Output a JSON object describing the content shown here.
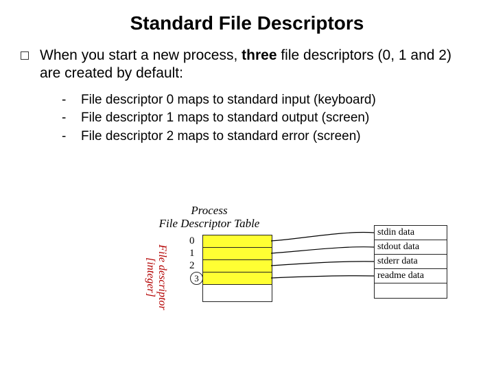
{
  "title": "Standard File Descriptors",
  "main_bullet_pre": "When you start a new process, ",
  "main_bullet_bold": "three",
  "main_bullet_post": " file descriptors (0, 1 and 2) are created by default:",
  "sub_items": [
    "File descriptor 0 maps to standard input (keyboard)",
    "File descriptor 1 maps to standard output (screen)",
    "File descriptor 2 maps to standard error (screen)"
  ],
  "diagram": {
    "title_line1": "Process",
    "title_line2": "File Descriptor Table",
    "fd_labels": [
      "0",
      "1",
      "2"
    ],
    "fd_circle": "3",
    "vert_label_line1": "File descriptor",
    "vert_label_line2": "[integer]",
    "data_rows": [
      "stdin data",
      "stdout data",
      "stderr data",
      "readme data",
      ""
    ]
  }
}
